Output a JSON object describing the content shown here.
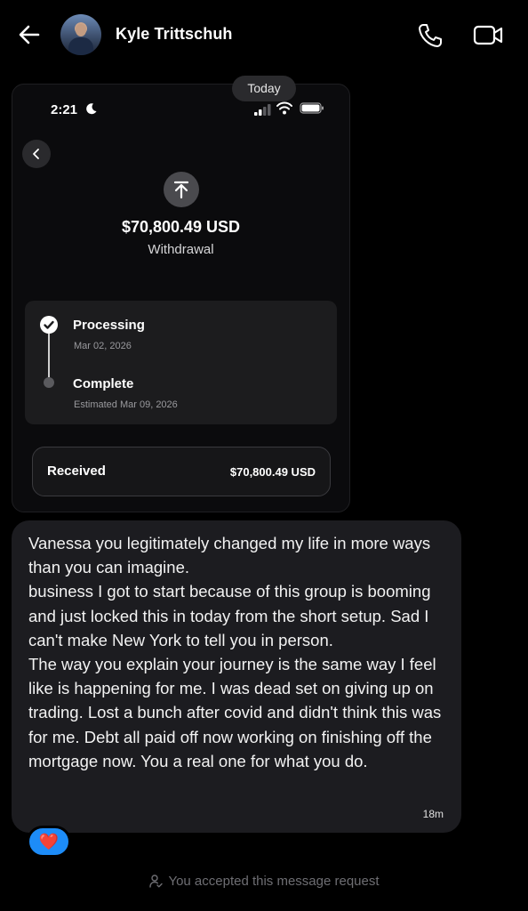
{
  "header": {
    "contact_name": "Kyle Trittschuh",
    "back_icon": "arrow-left-icon",
    "call_icon": "phone-icon",
    "video_icon": "video-camera-icon"
  },
  "date_separator": "Today",
  "shared_image": {
    "status_bar": {
      "time": "2:21"
    },
    "transaction": {
      "amount": "$70,800.49 USD",
      "type": "Withdrawal",
      "steps": [
        {
          "title": "Processing",
          "date": "Mar 02, 2026"
        },
        {
          "title": "Complete",
          "date": "Estimated Mar 09, 2026"
        }
      ],
      "received_label": "Received",
      "received_amount": "$70,800.49 USD"
    }
  },
  "message": {
    "text": "Vanessa you legitimately changed my life in more ways than you can imagine.\nbusiness I got to start because of this group is booming and just locked this in today from the short setup. Sad I can't make New York to tell you in person.\nThe way you explain your journey is the same way I feel like is happening for me. I was dead set on giving up on trading. Lost a bunch after covid and didn't think this was for me. Debt all paid off now working on finishing off the mortgage now. You a real one for what you do.",
    "time": "18m",
    "reaction": "❤️"
  },
  "footer": {
    "request_notice": "You accepted this message request"
  },
  "colors": {
    "background": "#000000",
    "bubble": "#1c1c20",
    "reaction_bg": "#1d8cf8",
    "muted_text": "#6e6e73"
  }
}
